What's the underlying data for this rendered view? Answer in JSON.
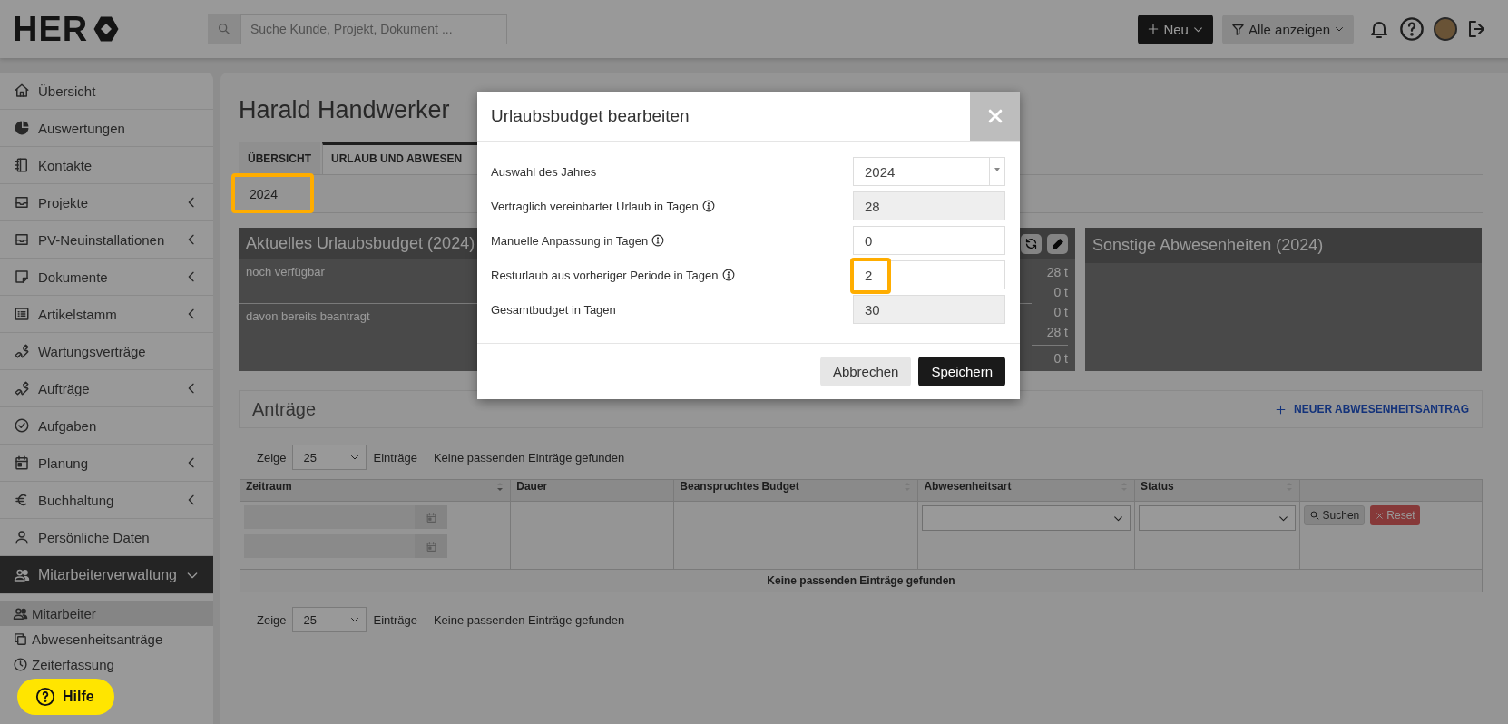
{
  "topbar": {
    "logo_text": "HER",
    "search": {
      "placeholder": "Suche Kunde, Projekt, Dokument ..."
    },
    "new_button": "Neu",
    "filter_button": "Alle anzeigen"
  },
  "sidebar": {
    "items": [
      {
        "label": "Übersicht",
        "expandable": false,
        "selected": false
      },
      {
        "label": "Auswertungen",
        "expandable": false,
        "selected": false
      },
      {
        "label": "Kontakte",
        "expandable": false,
        "selected": false
      },
      {
        "label": "Projekte",
        "expandable": true,
        "expanded": false,
        "selected": false
      },
      {
        "label": "PV-Neuinstallationen",
        "expandable": true,
        "expanded": false,
        "selected": false
      },
      {
        "label": "Dokumente",
        "expandable": true,
        "expanded": false,
        "selected": false
      },
      {
        "label": "Artikelstamm",
        "expandable": true,
        "expanded": false,
        "selected": false
      },
      {
        "label": "Wartungsverträge",
        "expandable": false,
        "selected": false
      },
      {
        "label": "Aufträge",
        "expandable": true,
        "expanded": false,
        "selected": false
      },
      {
        "label": "Aufgaben",
        "expandable": false,
        "selected": false
      },
      {
        "label": "Planung",
        "expandable": true,
        "expanded": false,
        "selected": false
      },
      {
        "label": "Buchhaltung",
        "expandable": true,
        "expanded": false,
        "selected": false
      },
      {
        "label": "Persönliche Daten",
        "expandable": false,
        "selected": false
      },
      {
        "label": "Mitarbeiterverwaltung",
        "expandable": true,
        "expanded": true,
        "selected": true,
        "children": [
          {
            "label": "Mitarbeiter",
            "selected": true
          },
          {
            "label": "Abwesenheitsanträge",
            "selected": false
          },
          {
            "label": "Zeiterfassung",
            "selected": false
          }
        ]
      }
    ]
  },
  "main": {
    "title": "Harald Handwerker",
    "tabs": [
      {
        "label": "ÜBERSICHT",
        "selected": false
      },
      {
        "label": "URLAUB UND ABWESEN",
        "selected": true
      }
    ],
    "year_select": {
      "value": "2024",
      "highlighted": true
    },
    "budget_panel": {
      "title": "Aktuelles Urlaubsbudget (2024)",
      "labels": [
        "noch verfügbar",
        "davon bereits beantragt"
      ],
      "value_groups": [
        [
          "28 t",
          "0 t",
          "0 t",
          "28 t"
        ],
        [
          "0 t"
        ]
      ]
    },
    "other_panel": {
      "title": "Sonstige Abwesenheiten (2024)"
    },
    "requests": {
      "title": "Anträge",
      "new_link": "NEUER ABWESENHEITSANTRAG",
      "top_pager": {
        "show_label": "Zeige",
        "page_size": "25",
        "entries_label": "Einträge",
        "info": "Keine passenden Einträge gefunden"
      },
      "columns": [
        {
          "label": "Zeitraum",
          "sortable": true,
          "sorted": true,
          "kind": "date_range"
        },
        {
          "label": "Dauer",
          "sortable": false,
          "kind": "plain"
        },
        {
          "label": "Beanspruchtes Budget",
          "sortable": true,
          "sorted": false,
          "kind": "plain"
        },
        {
          "label": "Abwesenheitsart",
          "sortable": true,
          "sorted": false,
          "kind": "select"
        },
        {
          "label": "Status",
          "sortable": true,
          "sorted": false,
          "kind": "select"
        },
        {
          "sortable": false,
          "kind": "actions"
        }
      ],
      "search_button": "Suchen",
      "reset_button": "Reset",
      "empty_message": "Keine passenden Einträge gefunden",
      "bottom_pager": {
        "show_label": "Zeige",
        "page_size": "25",
        "entries_label": "Einträge",
        "info": "Keine passenden Einträge gefunden"
      }
    }
  },
  "modal": {
    "title": "Urlaubsbudget bearbeiten",
    "fields": [
      {
        "label": "Auswahl des Jahres",
        "kind": "select",
        "value": "2024",
        "info": false,
        "highlighted": false
      },
      {
        "label": "Vertraglich vereinbarter Urlaub in Tagen",
        "kind": "readonly",
        "value": "28",
        "info": true,
        "highlighted": false
      },
      {
        "label": "Manuelle Anpassung in Tagen",
        "kind": "input",
        "value": "0",
        "info": true,
        "highlighted": false
      },
      {
        "label": "Resturlaub aus vorheriger Periode in Tagen",
        "kind": "input",
        "value": "2",
        "info": true,
        "highlighted": true
      },
      {
        "label": "Gesamtbudget in Tagen",
        "kind": "readonly",
        "value": "30",
        "info": false,
        "highlighted": false
      }
    ],
    "buttons": [
      {
        "label": "Abbrechen",
        "kind": "secondary"
      },
      {
        "label": "Speichern",
        "kind": "primary"
      }
    ]
  },
  "help": {
    "label": "Hilfe"
  }
}
